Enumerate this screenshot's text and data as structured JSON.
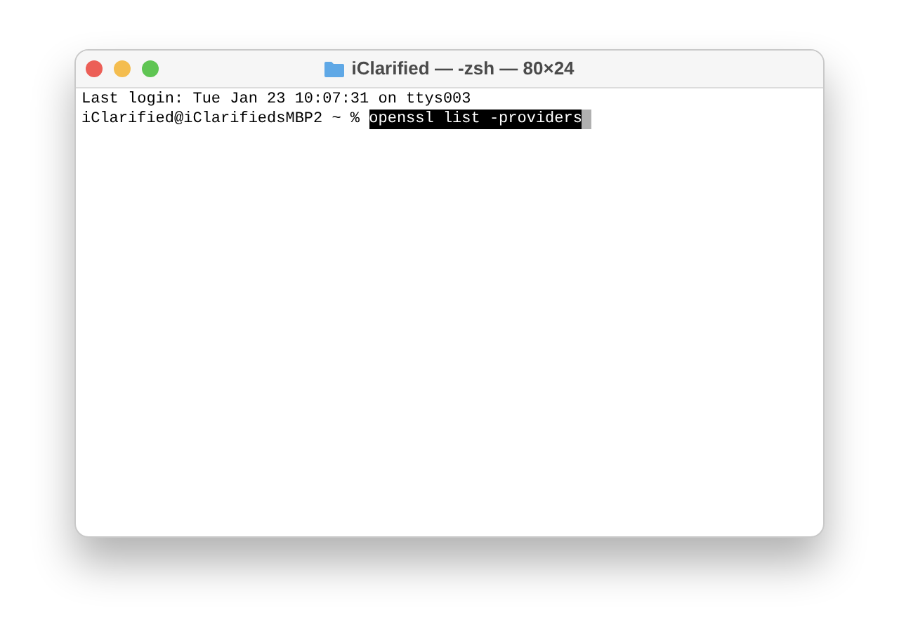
{
  "window": {
    "title": "iClarified — -zsh — 80×24"
  },
  "terminal": {
    "lines": [
      {
        "kind": "output",
        "text": "Last login: Tue Jan 23 10:07:31 on ttys003"
      },
      {
        "kind": "prompt",
        "prompt": "iClarified@iClarifiedsMBP2 ~ % ",
        "command": "openssl list -providers",
        "selected": true
      }
    ]
  }
}
